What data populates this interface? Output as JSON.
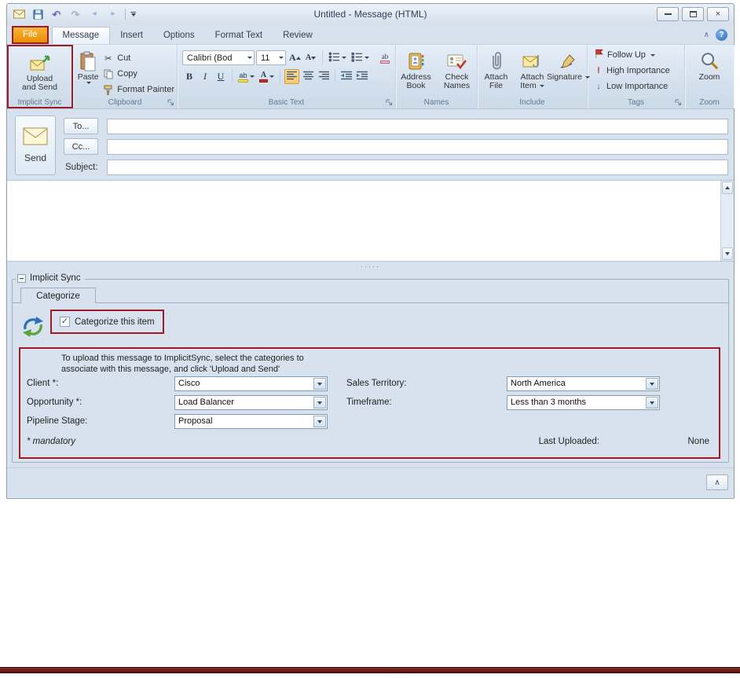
{
  "window": {
    "title": "Untitled - Message (HTML)"
  },
  "ribbon": {
    "tabs": [
      "File",
      "Message",
      "Insert",
      "Options",
      "Format Text",
      "Review"
    ],
    "implicit_sync": {
      "button_line1": "Upload",
      "button_line2": "and Send",
      "label": "Implicit Sync"
    },
    "clipboard": {
      "paste": "Paste",
      "cut": "Cut",
      "copy": "Copy",
      "format_painter": "Format Painter",
      "label": "Clipboard"
    },
    "basic_text": {
      "font_name": "Calibri (Bod",
      "font_size": "11",
      "label": "Basic Text"
    },
    "names": {
      "address_book_1": "Address",
      "address_book_2": "Book",
      "check_names_1": "Check",
      "check_names_2": "Names",
      "label": "Names"
    },
    "include": {
      "attach_file_1": "Attach",
      "attach_file_2": "File",
      "attach_item_1": "Attach",
      "attach_item_2": "Item",
      "signature": "Signature",
      "label": "Include"
    },
    "tags": {
      "follow_up": "Follow Up",
      "high": "High Importance",
      "low": "Low Importance",
      "label": "Tags"
    },
    "zoom": {
      "button": "Zoom",
      "label": "Zoom"
    }
  },
  "header": {
    "send": "Send",
    "to": "To...",
    "cc": "Cc...",
    "subject": "Subject:"
  },
  "sync_panel": {
    "group_label": "Implicit Sync",
    "tab": "Categorize",
    "checkbox": "Categorize this item",
    "instr1": "To upload this message to ImplicitSync, select the categories to",
    "instr2": "associate with this message, and click 'Upload and Send'",
    "fields": [
      {
        "label": "Client *:",
        "value": "Cisco"
      },
      {
        "label": "Opportunity *:",
        "value": "Load Balancer"
      },
      {
        "label": "Pipeline Stage:",
        "value": "Proposal"
      },
      {
        "label": "Sales Territory:",
        "value": "North America"
      },
      {
        "label": "Timeframe:",
        "value": "Less than 3 months"
      }
    ],
    "mandatory": "* mandatory",
    "last_uploaded_label": "Last Uploaded:",
    "last_uploaded_value": "None"
  },
  "icons": {
    "scissors": "✂",
    "undo": "↶",
    "redo": "↷",
    "back": "◂",
    "forward": "▸",
    "help": "?",
    "bold": "B",
    "italic": "I",
    "underline": "U",
    "grow_font": "A",
    "shrink_font": "A",
    "highlight": "ab",
    "font_color": "A",
    "clear_formatting": "ab",
    "high_importance": "!",
    "low_importance": "↓",
    "check": "✓",
    "chevron_up": "∧",
    "close": "×",
    "dots": "·····"
  },
  "colors": {
    "annotation": "#9b1c24",
    "file_tab": "#f2a434",
    "accent_bar": "#6e1c1c"
  }
}
